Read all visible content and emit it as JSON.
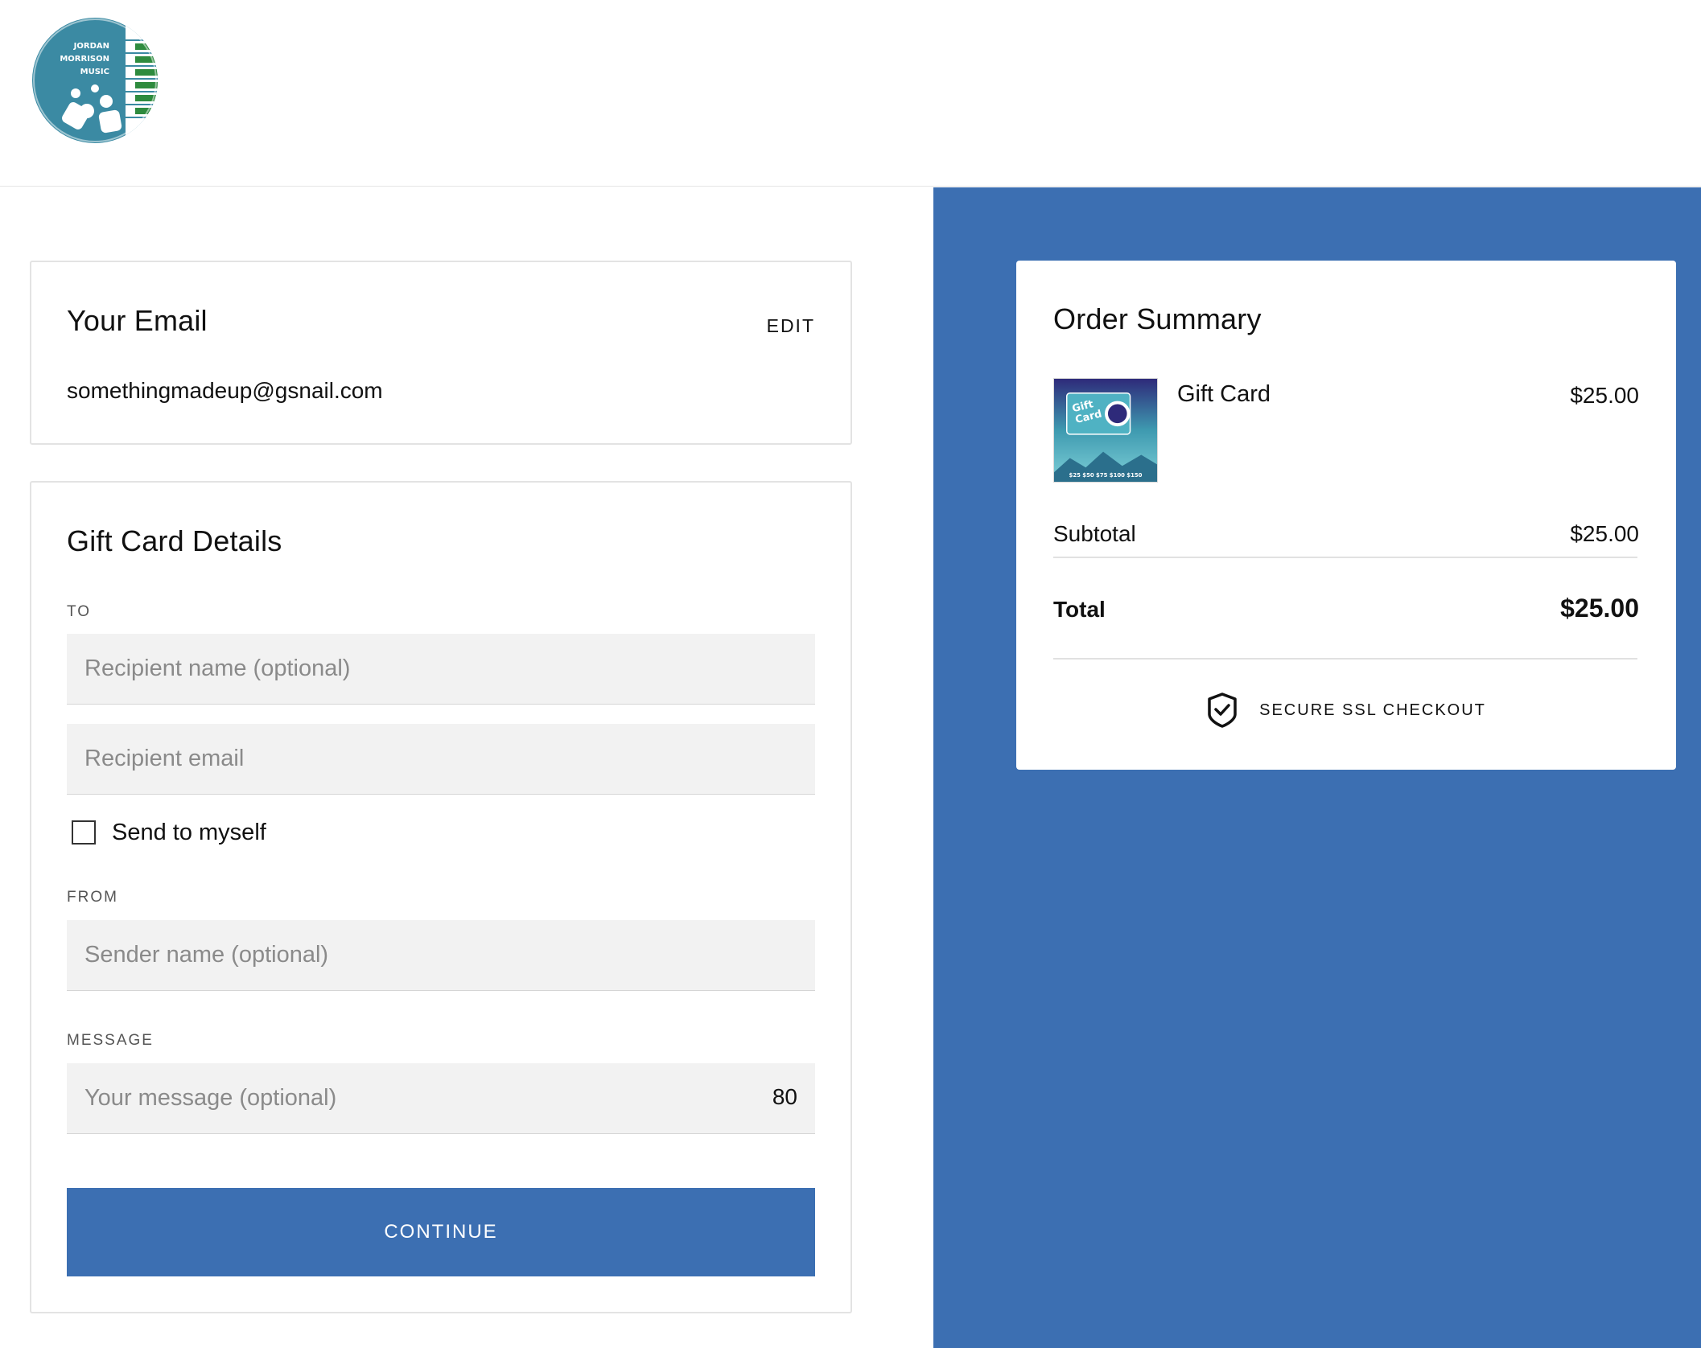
{
  "brand": {
    "logo_text_lines": [
      "JORDAN",
      "MORRISON",
      "MUSIC"
    ],
    "logo_colors": {
      "circle": "#3b8aa3",
      "keys_green": "#2e8b3e"
    }
  },
  "email_section": {
    "title": "Your Email",
    "edit_label": "EDIT",
    "email": "somethingmadeup@gsnail.com"
  },
  "gift_section": {
    "title": "Gift Card Details",
    "to_label": "TO",
    "recipient_name_placeholder": "Recipient name (optional)",
    "recipient_email_placeholder": "Recipient email",
    "send_to_myself_label": "Send to myself",
    "send_to_myself_checked": false,
    "from_label": "FROM",
    "sender_name_placeholder": "Sender name (optional)",
    "message_label": "MESSAGE",
    "message_placeholder": "Your message (optional)",
    "message_counter": "80",
    "continue_label": "CONTINUE"
  },
  "summary": {
    "title": "Order Summary",
    "item_name": "Gift Card",
    "item_price": "$25.00",
    "thumbnail_text": [
      "Gift",
      "Card"
    ],
    "thumbnail_amounts": "$25 $50 $75 $100 $150",
    "subtotal_label": "Subtotal",
    "subtotal_value": "$25.00",
    "total_label": "Total",
    "total_value": "$25.00",
    "secure_label": "SECURE SSL CHECKOUT"
  },
  "colors": {
    "accent": "#3c6fb2",
    "input_bg": "#f2f2f2",
    "card_border": "#e3e3e3"
  },
  "icons": [
    "shield-check-icon",
    "checkbox-icon"
  ]
}
